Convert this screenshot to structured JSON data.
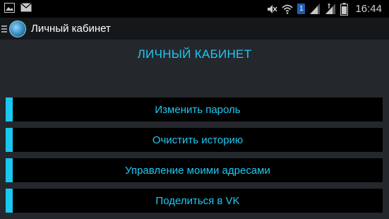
{
  "status_bar": {
    "time": "16:44",
    "sim_badge": "1",
    "icons": [
      "image-icon",
      "email-icon",
      "mute-icon",
      "wifi-icon",
      "signal-icon-sim1",
      "signal-icon-sim2",
      "battery-icon"
    ]
  },
  "action_bar": {
    "title": "Личный кабинет",
    "logo_icon": "app-logo-icon"
  },
  "page": {
    "heading": "ЛИЧНЫЙ КАБИНЕТ"
  },
  "menu": {
    "items": [
      {
        "label": "Изменить пароль"
      },
      {
        "label": "Очистить историю"
      },
      {
        "label": "Управление моими адресами"
      },
      {
        "label": "Поделиться в VK"
      }
    ]
  },
  "colors": {
    "accent": "#1ec8f2",
    "background": "#24282d",
    "button_bg": "#000000"
  }
}
